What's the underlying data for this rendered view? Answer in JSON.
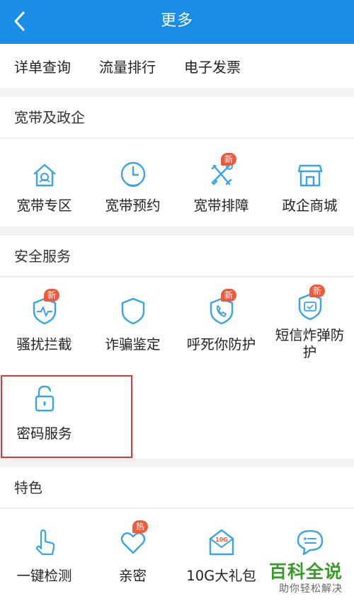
{
  "header": {
    "title": "更多"
  },
  "quick_links": [
    "详单查询",
    "流量排行",
    "电子发票"
  ],
  "sections": {
    "broadband": {
      "title": "宽带及政企",
      "items": [
        {
          "label": "宽带专区",
          "icon": "house-icon"
        },
        {
          "label": "宽带预约",
          "icon": "clock-icon"
        },
        {
          "label": "宽带排障",
          "icon": "tools-icon",
          "badge": "新"
        },
        {
          "label": "政企商城",
          "icon": "store-icon"
        }
      ]
    },
    "security": {
      "title": "安全服务",
      "items": [
        {
          "label": "骚扰拦截",
          "icon": "shield-pulse-icon",
          "badge": "新"
        },
        {
          "label": "诈骗鉴定",
          "icon": "shield-icon"
        },
        {
          "label": "呼死你防护",
          "icon": "shield-phone-icon",
          "badge": "新"
        },
        {
          "label": "短信炸弹防护",
          "icon": "shield-message-icon",
          "badge": "新"
        },
        {
          "label": "密码服务",
          "icon": "lock-icon"
        }
      ]
    },
    "featured": {
      "title": "特色",
      "items": [
        {
          "label": "一键检测",
          "icon": "finger-tap-icon"
        },
        {
          "label": "亲密",
          "icon": "heart-icon",
          "badge": "热"
        },
        {
          "label": "10G大礼包",
          "icon": "gift-envelope-icon",
          "envelope_text": "10G"
        },
        {
          "label": "",
          "icon": "chat-bubble-icon"
        }
      ]
    }
  },
  "watermark": {
    "main": "百科全说",
    "sub": "助你轻松解决"
  },
  "colors": {
    "header": "#1a8ee6",
    "icon": "#3aa3e8",
    "badge": "#ef5a3a",
    "highlight": "#d33a3a",
    "watermark": "#3b9b2a"
  }
}
